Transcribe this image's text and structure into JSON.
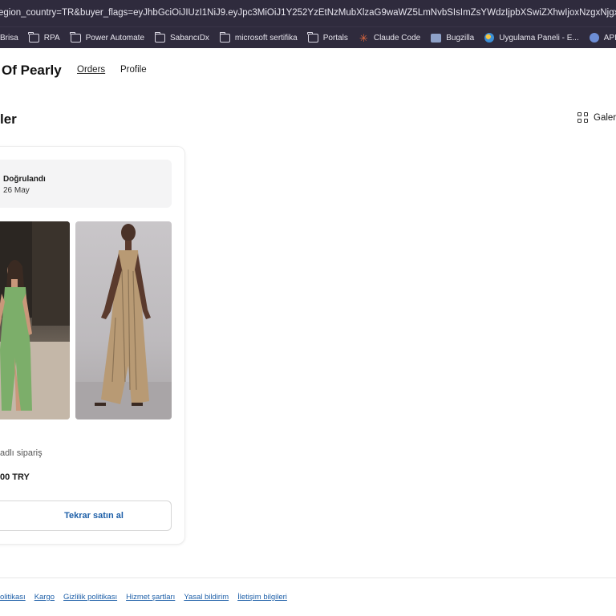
{
  "browser": {
    "url_text": "egion_country=TR&buyer_flags=eyJhbGciOiJIUzI1NiJ9.eyJpc3MiOiJ1Y252YzEtNzMubXlzaG9waWZ5LmNvbSIsImZsYWdzIjpbXSwiZXhwIjoxNzgxNjgxMDIxLCJuYmYi"
  },
  "bookmarks": [
    {
      "label": "Brisa",
      "icon": "none"
    },
    {
      "label": "RPA",
      "icon": "folder-icon"
    },
    {
      "label": "Power Automate",
      "icon": "folder-icon"
    },
    {
      "label": "SabancıDx",
      "icon": "folder-icon"
    },
    {
      "label": "microsoft sertifika",
      "icon": "folder-icon"
    },
    {
      "label": "Portals",
      "icon": "folder-icon"
    },
    {
      "label": "Claude Code",
      "icon": "claude-icon"
    },
    {
      "label": "Bugzilla",
      "icon": "bugzilla-icon"
    },
    {
      "label": "Uygulama Paneli - E...",
      "icon": "globe-icon"
    },
    {
      "label": "APIC Developer",
      "icon": "apic-icon"
    }
  ],
  "header": {
    "brand": "Of Pearly",
    "nav_orders": "Orders",
    "nav_profile": "Profile"
  },
  "main": {
    "title": "ler",
    "view_toggle": "Galeri"
  },
  "order": {
    "status": "Doğrulandı",
    "date": "26 May",
    "type_text": "adlı sipariş",
    "total": "00 TRY",
    "rebuy_label": "Tekrar satın al"
  },
  "footer": {
    "links": [
      "olitikası",
      "Kargo",
      "Gizlilik politikası",
      "Hizmet şartları",
      "Yasal bildirim",
      "İletişim bilgileri"
    ]
  },
  "colors": {
    "browser_chrome": "#2f2b3d",
    "link_blue": "#1d5fa8"
  }
}
